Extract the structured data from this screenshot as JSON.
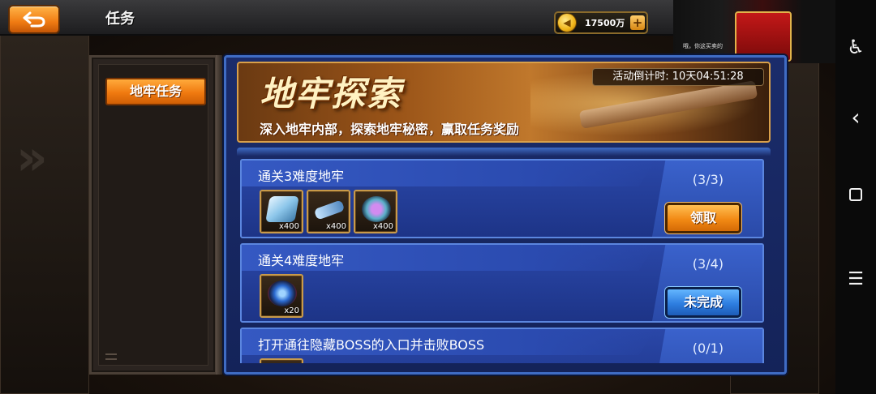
{
  "header": {
    "title": "任务",
    "back_icon": "back-arrow-icon",
    "currency": {
      "icon": "gold-coin-icon",
      "value": "17500万",
      "plus_label": "+"
    }
  },
  "sidebar": {
    "tabs": [
      {
        "label": "地牢任务",
        "active": true
      }
    ]
  },
  "banner": {
    "title": "地牢探索",
    "subtitle": "深入地牢内部，探索地牢秘密，赢取任务奖励",
    "countdown": "活动倒计时: 10天04:51:28"
  },
  "tasks": [
    {
      "title": "通关3难度地牢",
      "progress": "(3/3)",
      "rewards": [
        {
          "icon": "ingot-item-icon",
          "qty": "x400"
        },
        {
          "icon": "gun-part-item-icon",
          "qty": "x400"
        },
        {
          "icon": "knot-item-icon",
          "qty": "x400"
        }
      ],
      "button_label": "领取",
      "status": "claimable"
    },
    {
      "title": "通关4难度地牢",
      "progress": "(3/4)",
      "rewards": [
        {
          "icon": "gem-core-item-icon",
          "qty": "x20"
        }
      ],
      "button_label": "未完成",
      "status": "incomplete"
    },
    {
      "title": "打开通往隐藏BOSS的入口并击败BOSS",
      "progress": "(0/1)",
      "rewards": [],
      "button_label": "",
      "status": "incomplete"
    }
  ],
  "video_overlay": {
    "caption": "哦，你这买卖的"
  },
  "system_nav": {
    "accessibility_icon": "accessibility-icon",
    "back_icon": "nav-back-icon",
    "home_icon": "nav-home-icon",
    "menu_icon": "nav-menu-icon"
  },
  "colors": {
    "accent_orange": "#f07a10",
    "panel_blue": "#1b2c6b",
    "button_blue": "#2e7ee0",
    "gold_border": "#d9a04a"
  }
}
